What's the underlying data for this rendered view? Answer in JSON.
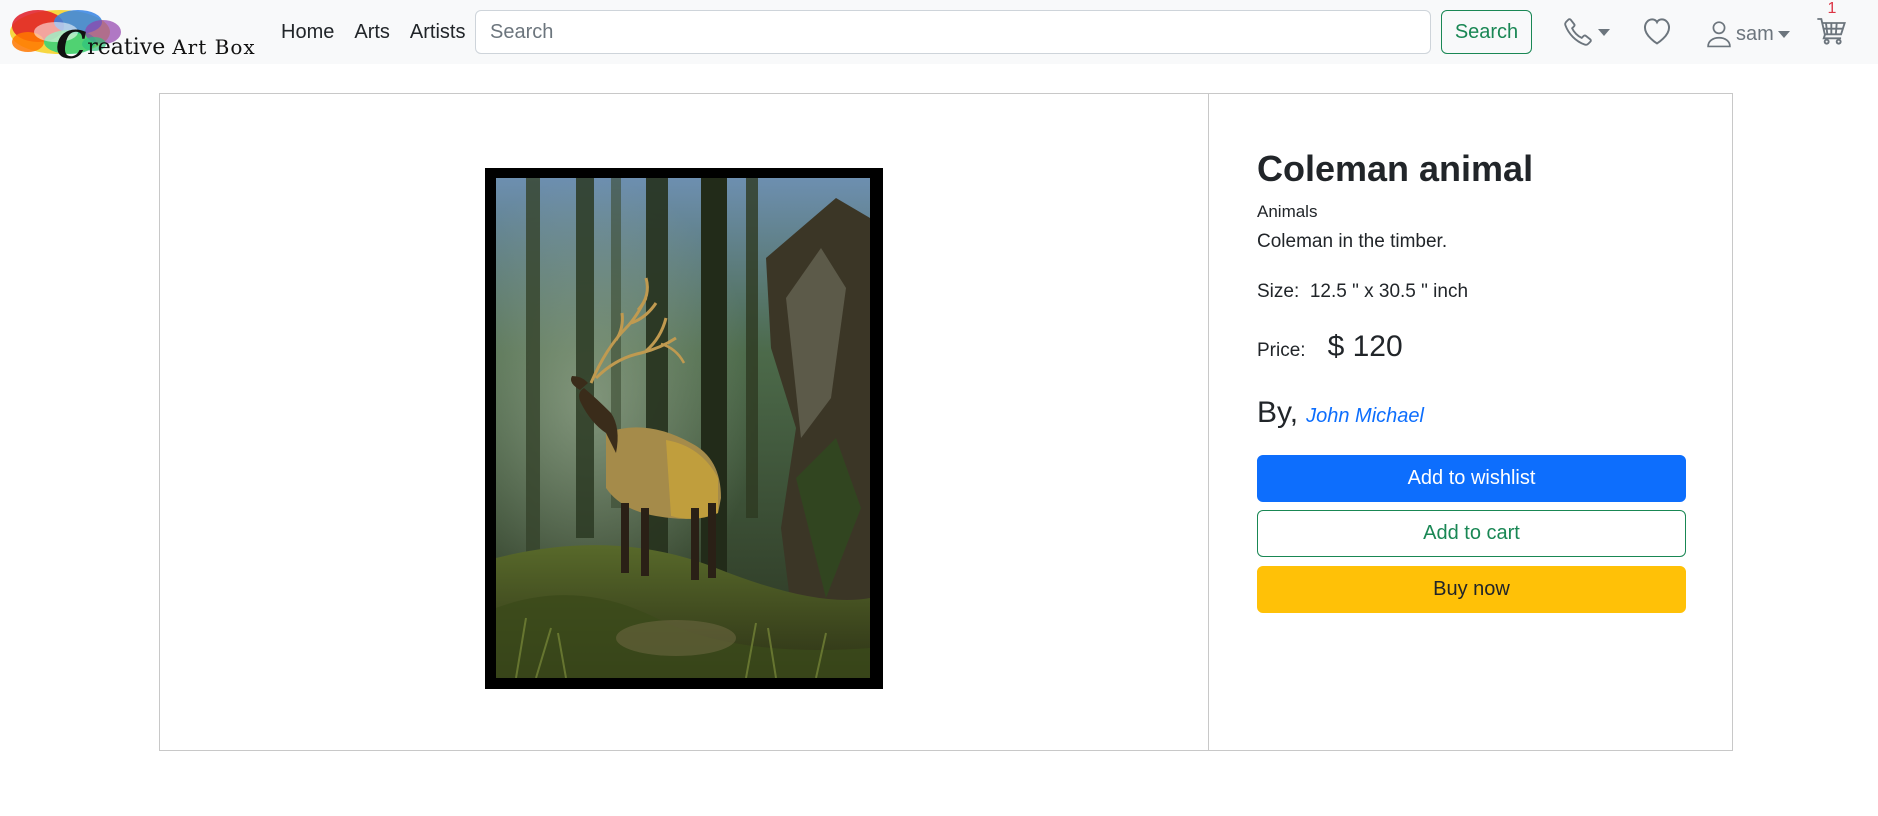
{
  "brand": {
    "name": "Creative Art Box",
    "logo_letter": "C",
    "logo_rest": "reative",
    "logo_tail": "Art Box"
  },
  "nav": {
    "links": [
      "Home",
      "Arts",
      "Artists"
    ]
  },
  "search": {
    "placeholder": "Search",
    "value": "",
    "button_label": "Search"
  },
  "header_icons": {
    "phone": "phone-icon",
    "wishlist": "heart-icon",
    "user": "person-icon",
    "cart": "cart-icon",
    "username": "sam",
    "cart_count": "1"
  },
  "product": {
    "title": "Coleman animal",
    "category": "Animals",
    "description": "Coleman in the timber.",
    "size_label": "Size:",
    "size_value": "12.5 \" x 30.5 \" inch",
    "price_label": "Price:",
    "price_value": "$ 120",
    "by_label": "By,",
    "artist": "John Michael"
  },
  "actions": {
    "wishlist": "Add to wishlist",
    "cart": "Add to cart",
    "buy": "Buy now"
  },
  "colors": {
    "primary": "#0d6efd",
    "success": "#198754",
    "warning": "#ffc107",
    "badge": "#dc3545"
  }
}
